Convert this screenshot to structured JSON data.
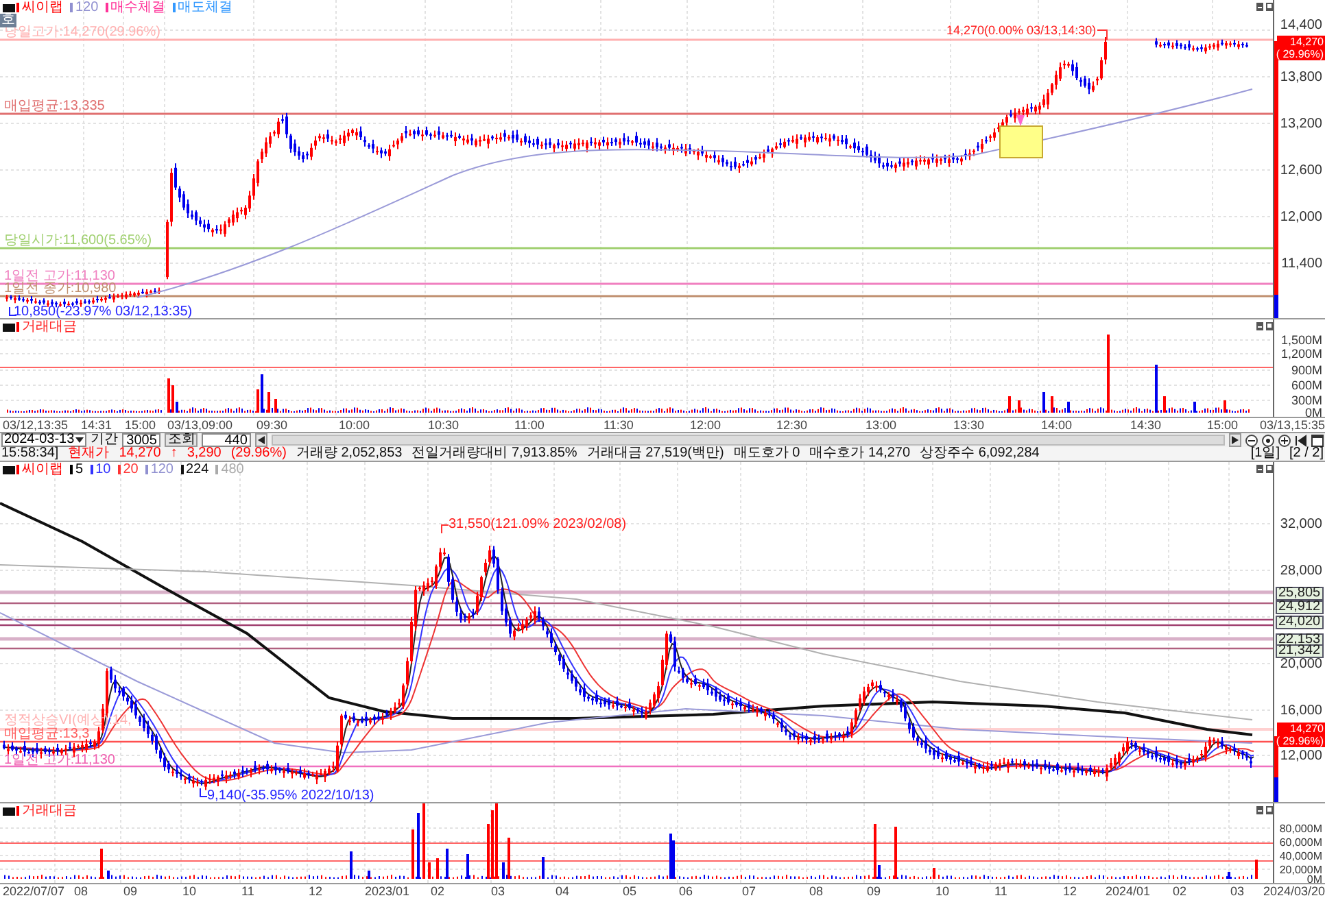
{
  "top_chart": {
    "mode_button": "호",
    "legend": [
      {
        "label": "씨이랩",
        "color": "#ff0000"
      },
      {
        "label": "120",
        "color": "#9090d0"
      },
      {
        "label": "매수체결",
        "color": "#ff3399"
      },
      {
        "label": "매도체결",
        "color": "#3399ff"
      }
    ],
    "reference_lines": [
      {
        "label": "당일고가:14,270(29.96%)",
        "color": "#ffb0b0"
      },
      {
        "label": "매입평균:13,335",
        "color": "#e07070"
      },
      {
        "label": "당일시가:11,600(5.65%)",
        "color": "#a0d070"
      },
      {
        "label": "1일전 고가:11,130",
        "color": "#f080c0"
      },
      {
        "label": "1일전 종가:10,980",
        "color": "#c09070"
      }
    ],
    "high_annotation": "14,270(0.00% 03/13,14:30)",
    "low_annotation": "10,850(-23.97% 03/12,13:35)",
    "y_ticks": [
      "14,400",
      "13,800",
      "13,200",
      "12,600",
      "12,000",
      "11,400"
    ],
    "price_badge": {
      "price": "14,270",
      "change": "( 29.96%)"
    }
  },
  "top_volume": {
    "legend": "거래대금",
    "y_ticks": [
      "1,500M",
      "1,200M",
      "900M",
      "600M",
      "300M",
      "0M"
    ]
  },
  "time_axis": [
    "03/12,13:35",
    "14:31",
    "15:00",
    "03/13,09:00",
    "09:30",
    "10:00",
    "10:30",
    "11:00",
    "11:30",
    "12:00",
    "12:30",
    "13:00",
    "13:30",
    "14:00",
    "14:30",
    "15:00",
    "03/13,15:35"
  ],
  "toolbar": {
    "date": "2024-03-13",
    "period_label": "기간",
    "period": "3005",
    "query_label": "조회",
    "count": "440"
  },
  "status_bar": {
    "segments": [
      {
        "text": "15:58:34]",
        "kind": "plain"
      },
      {
        "text": "현재가",
        "kind": "up"
      },
      {
        "text": "14,270",
        "kind": "up"
      },
      {
        "text": "↑",
        "kind": "up"
      },
      {
        "text": "3,290",
        "kind": "up"
      },
      {
        "text": "(29.96%)",
        "kind": "up"
      },
      {
        "text": "거래량 2,052,853",
        "kind": "plain"
      },
      {
        "text": "전일거래량대비 7,913.85%",
        "kind": "plain"
      },
      {
        "text": "거래대금 27,519(백만)",
        "kind": "plain"
      },
      {
        "text": "매도호가 0",
        "kind": "plain"
      },
      {
        "text": "매수호가 14,270",
        "kind": "plain"
      },
      {
        "text": "상장주수 6,092,284",
        "kind": "plain"
      }
    ],
    "pages": [
      "[1일]",
      "[2 / 2]"
    ]
  },
  "bottom_chart": {
    "legend": [
      {
        "label": "씨이랩",
        "color": "#ff0000"
      },
      {
        "label": "5",
        "color": "#000000"
      },
      {
        "label": "10",
        "color": "#3333ff"
      },
      {
        "label": "20",
        "color": "#ff3333"
      },
      {
        "label": "120",
        "color": "#9090d0"
      },
      {
        "label": "224",
        "color": "#111111"
      },
      {
        "label": "480",
        "color": "#aaaaaa"
      }
    ],
    "high_annotation": "31,550(121.09% 2023/02/08)",
    "low_annotation": "9,140(-35.95% 2022/10/13)",
    "reference_labels": [
      "정적상승VI(예상):14,",
      "매입평균:13,3",
      "1일전 고가:11,130"
    ],
    "level_boxes": [
      "25,805",
      "24,912",
      "24,020",
      "22,153",
      "21,342"
    ],
    "y_ticks": [
      "32,000",
      "28,000",
      "20,000",
      "16,000",
      "12,000"
    ],
    "price_badge": {
      "price": "14,270",
      "change": "( 29.96%)"
    }
  },
  "bottom_volume": {
    "legend": "거래대금",
    "y_ticks": [
      "80,000M",
      "60,000M",
      "40,000M",
      "20,000M",
      "0M"
    ]
  },
  "date_axis": [
    "2022/07/07",
    "08",
    "09",
    "10",
    "11",
    "12",
    "2023/01",
    "02",
    "03",
    "04",
    "05",
    "06",
    "07",
    "08",
    "09",
    "10",
    "11",
    "12",
    "2024/01",
    "02",
    "03",
    "2024/03/20"
  ]
}
